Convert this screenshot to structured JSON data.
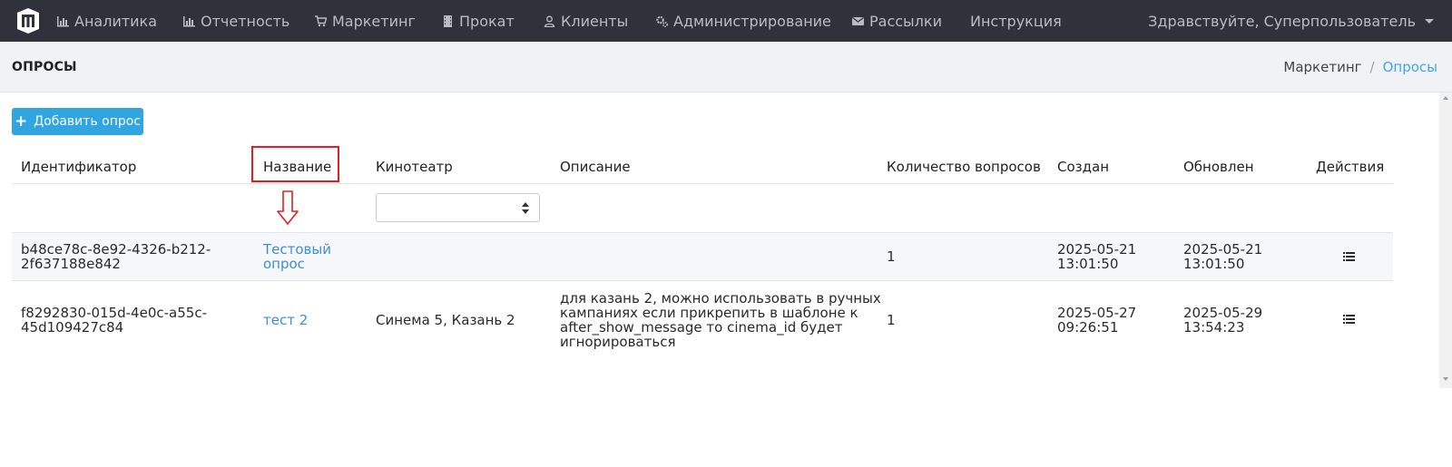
{
  "nav": {
    "items": [
      {
        "label": "Аналитика",
        "icon": "bar-chart-icon"
      },
      {
        "label": "Отчетность",
        "icon": "bar-chart-icon"
      },
      {
        "label": "Маркетинг",
        "icon": "cart-icon"
      },
      {
        "label": "Прокат",
        "icon": "film-icon"
      },
      {
        "label": "Клиенты",
        "icon": "user-icon"
      },
      {
        "label": "Администрирование",
        "icon": "gears-icon"
      },
      {
        "label": "Рассылки",
        "icon": "envelope-icon"
      },
      {
        "label": "Инструкция",
        "icon": ""
      }
    ],
    "user_greeting": "Здравствуйте, Суперпользователь"
  },
  "page": {
    "title": "ОПРОСЫ",
    "breadcrumb": {
      "parent": "Маркетинг",
      "separator": "/",
      "current": "Опросы"
    }
  },
  "toolbar": {
    "add_label": "Добавить опрос"
  },
  "table": {
    "columns": [
      "Идентификатор",
      "Название",
      "Кинотеатр",
      "Описание",
      "Количество вопросов",
      "Создан",
      "Обновлен",
      "Действия"
    ],
    "rows": [
      {
        "id_line1": "b48ce78c-8e92-4326-b212-",
        "id_line2": "2f637188e842",
        "name_line1": "Тестовый",
        "name_line2": "опрос",
        "cinema": "",
        "description": "",
        "questions": "1",
        "created_date": "2025-05-21",
        "created_time": "13:01:50",
        "updated_date": "2025-05-21",
        "updated_time": "13:01:50"
      },
      {
        "id_line1": "f8292830-015d-4e0c-a55c-",
        "id_line2": "45d109427c84",
        "name_line1": "тест 2",
        "name_line2": "",
        "cinema": "Синема 5, Казань 2",
        "desc_line1": "для казань 2, можно использовать в ручных",
        "desc_line2": "кампаниях если прикрепить в шаблоне к",
        "desc_line3": "after_show_message то cinema_id будет",
        "desc_line4": "игнорироваться",
        "questions": "1",
        "created_date": "2025-05-27",
        "created_time": "09:26:51",
        "updated_date": "2025-05-29",
        "updated_time": "13:54:23"
      }
    ]
  },
  "colors": {
    "navbar": "#2f323a",
    "accent": "#30a5df",
    "link": "#3b8fd9",
    "annotation": "#e02020"
  }
}
